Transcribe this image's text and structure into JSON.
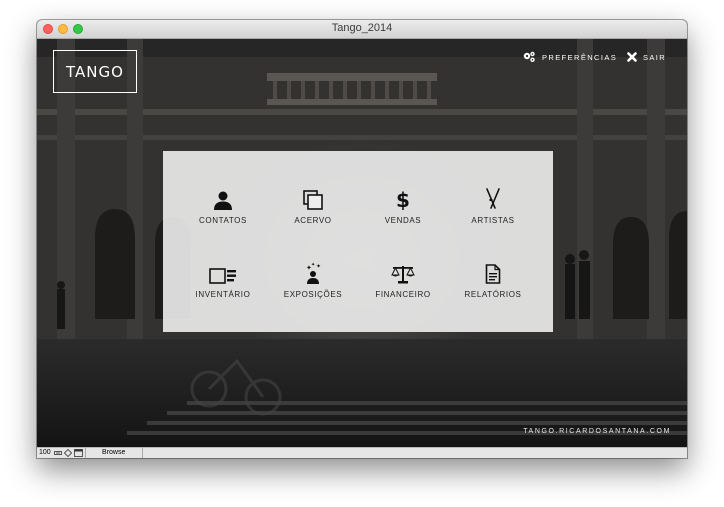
{
  "window": {
    "title": "Tango_2014"
  },
  "header": {
    "logo": "TANGO",
    "preferences_label": "PREFERÊNCIAS",
    "exit_label": "SAIR"
  },
  "menu": {
    "row1": [
      {
        "label": "CONTATOS",
        "icon": "user-silhouette-icon"
      },
      {
        "label": "ACERVO",
        "icon": "stacked-frames-icon"
      },
      {
        "label": "VENDAS",
        "icon": "dollar-icon"
      },
      {
        "label": "ARTISTAS",
        "icon": "brushes-icon"
      }
    ],
    "row2": [
      {
        "label": "INVENTÁRIO",
        "icon": "inventory-list-icon"
      },
      {
        "label": "EXPOSIÇÕES",
        "icon": "exhibition-icon"
      },
      {
        "label": "FINANCEIRO",
        "icon": "scales-icon"
      },
      {
        "label": "RELATÓRIOS",
        "icon": "document-icon"
      }
    ]
  },
  "footer": {
    "url": "TANGO.RICARDOSANTANA.COM"
  },
  "statusbar": {
    "zoom": "100",
    "mode": "Browse"
  },
  "colors": {
    "panel": "#eeeeee",
    "text": "#222222",
    "window_bg": "#232323"
  }
}
